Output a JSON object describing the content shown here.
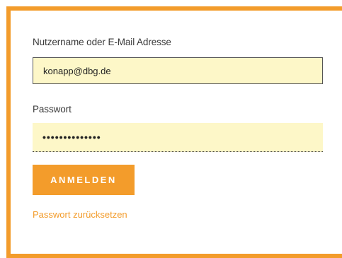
{
  "form": {
    "username_label": "Nutzername oder E-Mail Adresse",
    "username_value": "konapp@dbg.de",
    "password_label": "Passwort",
    "password_value": "••••••••••••••",
    "login_button": "ANMELDEN",
    "reset_link": "Passwort zurücksetzen"
  },
  "colors": {
    "accent": "#f39c2b",
    "field_background": "#fdf7c8"
  }
}
